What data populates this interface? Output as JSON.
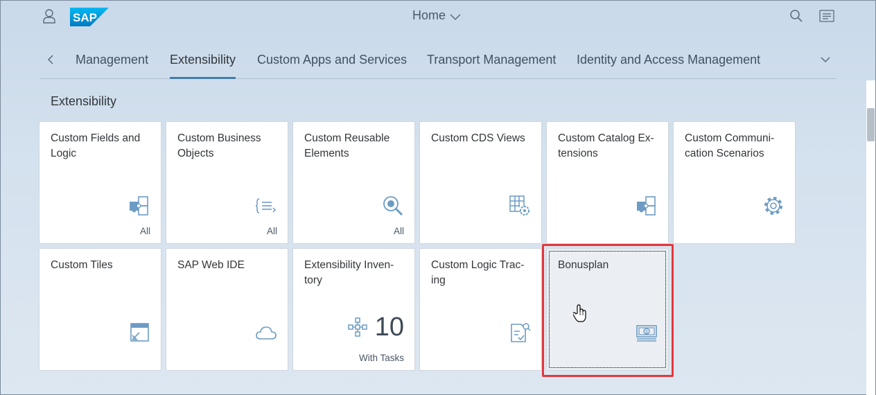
{
  "shell": {
    "title": "Home",
    "logo_text": "SAP"
  },
  "tabs": [
    {
      "label": "Management",
      "selected": false
    },
    {
      "label": "Extensibility",
      "selected": true
    },
    {
      "label": "Custom Apps and Services",
      "selected": false
    },
    {
      "label": "Transport Management",
      "selected": false
    },
    {
      "label": "Identity and Access Management",
      "selected": false
    }
  ],
  "section": {
    "title": "Extensibility"
  },
  "tiles": [
    {
      "title": "Custom Fields and Logic",
      "footer": "All",
      "icon": "puzzle-icon"
    },
    {
      "title": "Custom Business Objects",
      "footer": "All",
      "icon": "expand-list-icon"
    },
    {
      "title": "Custom Reusable Elements",
      "footer": "All",
      "icon": "search-settings-icon"
    },
    {
      "title": "Custom CDS Views",
      "footer": "",
      "icon": "grid-gear-icon"
    },
    {
      "title": "Custom Catalog Ex-tensions",
      "footer": "",
      "icon": "puzzle-icon"
    },
    {
      "title": "Custom Communi-cation Scenarios",
      "footer": "",
      "icon": "gear-icon"
    },
    {
      "title": "Custom Tiles",
      "footer": "",
      "icon": "tile-launch-icon"
    },
    {
      "title": "SAP Web IDE",
      "footer": "",
      "icon": "cloud-icon"
    },
    {
      "title": "Extensibility Inven-tory",
      "footer": "With Tasks",
      "icon": "network-icon",
      "kpi": "10"
    },
    {
      "title": "Custom Logic Trac-ing",
      "footer": "",
      "icon": "document-check-icon"
    },
    {
      "title": "Bonusplan",
      "footer": "",
      "icon": "money-bills-icon"
    }
  ],
  "colors": {
    "accent": "#427cac",
    "highlight": "#e2383c",
    "icon": "#6c9bc4"
  }
}
